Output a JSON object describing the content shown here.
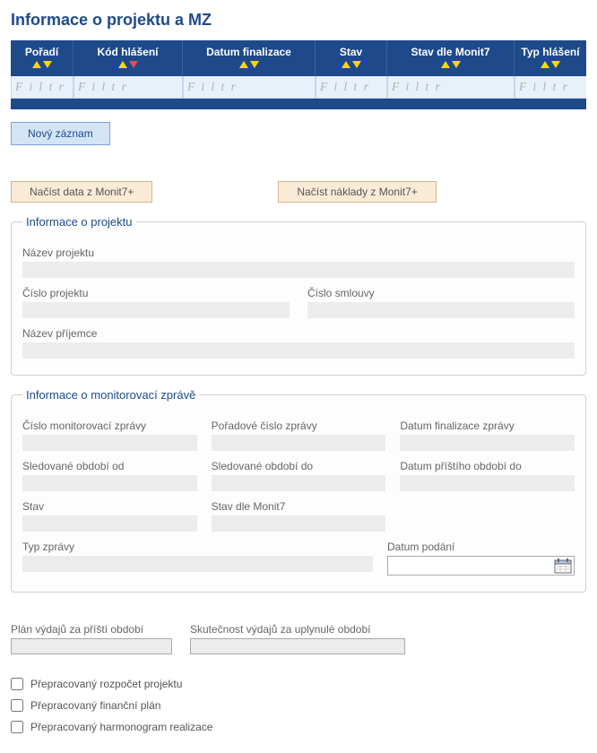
{
  "title": "Informace o projektu a MZ",
  "columns": {
    "poradi": "Pořadí",
    "kod": "Kód hlášení",
    "datum": "Datum finalizace",
    "stav": "Stav",
    "stavmonit": "Stav dle Monit7",
    "typ": "Typ hlášení"
  },
  "filter_placeholder": "F i l t r",
  "buttons": {
    "new_record": "Nový záznam",
    "load_data": "Načíst data z Monit7+",
    "load_costs": "Načíst náklady z Monit7+"
  },
  "fieldset1": {
    "legend": "Informace o projektu",
    "nazev_projektu": "Název projektu",
    "cislo_projektu": "Číslo projektu",
    "cislo_smlouvy": "Číslo smlouvy",
    "nazev_prijemce": "Název příjemce"
  },
  "fieldset2": {
    "legend": "Informace o monitorovací zprávě",
    "cislo_mz": "Číslo monitorovací zprávy",
    "poradove": "Pořadové číslo zprávy",
    "datum_final": "Datum finalizace zprávy",
    "obdobi_od": "Sledované období od",
    "obdobi_do": "Sledované období do",
    "pristi_do": "Datum příštího období do",
    "stav": "Stav",
    "stav_monit": "Stav dle Monit7",
    "typ_zpravy": "Typ zprávy",
    "datum_podani": "Datum podání"
  },
  "below": {
    "plan": "Plán výdajů za příští období",
    "skutecnost": "Skutečnost výdajů za uplynulé období"
  },
  "checkboxes": {
    "rozpocet": "Přepracovaný rozpočet projektu",
    "financni": "Přepracovaný finanční plán",
    "harmonogram": "Přepracovaný harmonogram realizace"
  }
}
